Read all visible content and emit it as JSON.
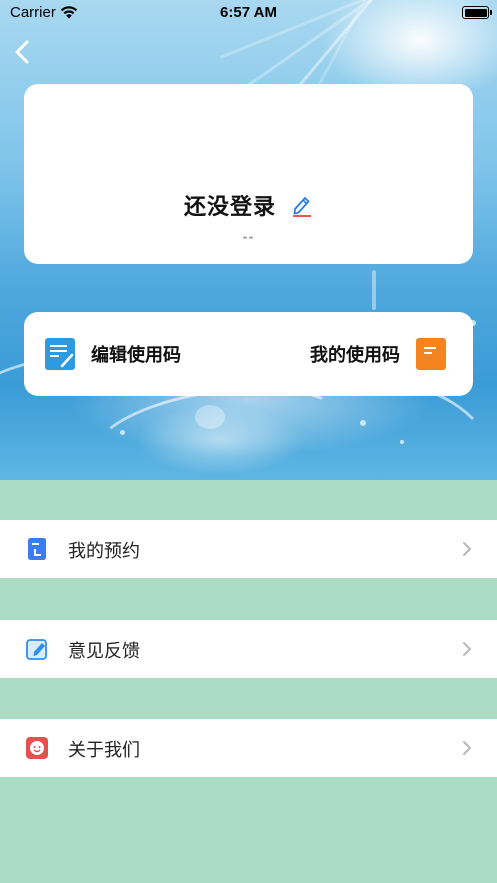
{
  "status_bar": {
    "carrier": "Carrier",
    "time": "6:57 AM"
  },
  "profile": {
    "title": "还没登录",
    "subtitle": "--"
  },
  "codes": {
    "edit_label": "编辑使用码",
    "mine_label": "我的使用码"
  },
  "menu": {
    "items": [
      {
        "label": "我的预约",
        "icon": "booking-icon",
        "icon_color": "#3b7cf3"
      },
      {
        "label": "意见反馈",
        "icon": "feedback-edit-icon",
        "icon_color": "#2f8ff0"
      },
      {
        "label": "关于我们",
        "icon": "smile-face-icon",
        "icon_color": "#e8504f"
      }
    ]
  },
  "colors": {
    "page_background": "#acdcc4",
    "edit_code_icon": "#2e9be0",
    "my_code_icon": "#f5841f",
    "arrow": "#b8b8b8"
  }
}
